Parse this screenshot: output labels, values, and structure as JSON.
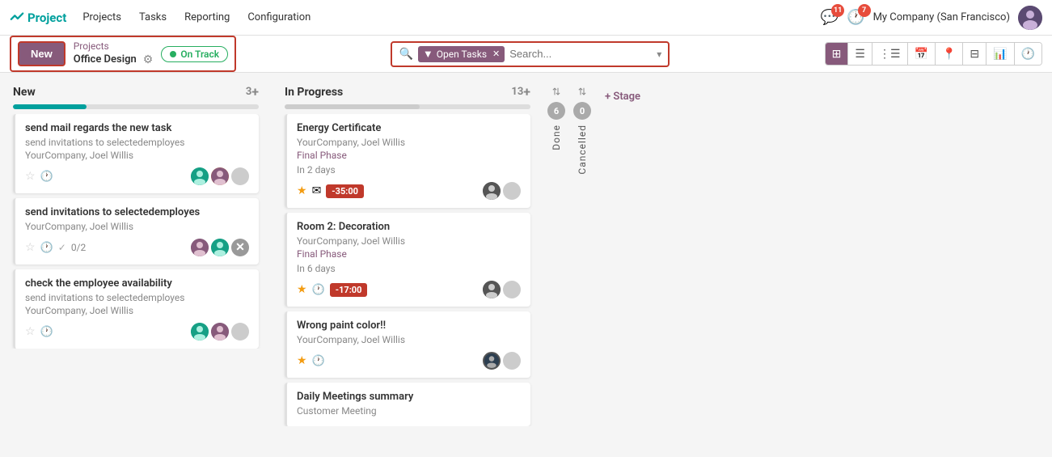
{
  "nav": {
    "logo": "Project",
    "items": [
      "Projects",
      "Tasks",
      "Reporting",
      "Configuration"
    ],
    "messages_count": "11",
    "activities_count": "7",
    "company": "My Company (San Francisco)"
  },
  "breadcrumb": {
    "new_label": "New",
    "project_label": "Projects",
    "current_label": "Office Design",
    "status_label": "On Track"
  },
  "search": {
    "filter_label": "Open Tasks",
    "placeholder": "Search...",
    "dropdown_arrow": "▾"
  },
  "view_buttons": [
    "kanban",
    "list",
    "list2",
    "calendar",
    "pin",
    "grid",
    "chart",
    "clock"
  ],
  "columns": [
    {
      "id": "new",
      "title": "New",
      "count": "3",
      "progress": 30,
      "progress_color": "#00a09d",
      "cards": [
        {
          "id": "c1",
          "title": "send mail regards the new task",
          "subtitle": "send invitations to selectedemployes",
          "company": "YourCompany, Joel Willis",
          "star": false,
          "has_clock": true,
          "subtask_label": null,
          "avatars": [
            "avatar1",
            "avatar2",
            "avatar-grey"
          ]
        },
        {
          "id": "c2",
          "title": "send invitations to selectedemployes",
          "company": "YourCompany, Joel Willis",
          "star": false,
          "has_clock": true,
          "subtask_label": "0/2",
          "avatars": [
            "avatar3",
            "avatar4",
            "avatar-x"
          ]
        },
        {
          "id": "c3",
          "title": "check the employee availability",
          "subtitle": "send invitations to selectedemployes",
          "company": "YourCompany, Joel Willis",
          "star": false,
          "has_clock": true,
          "subtask_label": null,
          "avatars": [
            "avatar1",
            "avatar2",
            "avatar-grey"
          ]
        }
      ]
    },
    {
      "id": "in-progress",
      "title": "In Progress",
      "count": "13",
      "progress": 55,
      "progress_color": "#aaa",
      "cards": [
        {
          "id": "c4",
          "title": "Energy Certificate",
          "subtitle": "YourCompany, Joel Willis",
          "tag": "Final Phase",
          "deadline": "In 2 days",
          "deadline_overdue": false,
          "star": true,
          "has_clock": false,
          "has_mail": true,
          "timer": "-35:00",
          "avatars": [
            "avatar5",
            "avatar-grey2"
          ]
        },
        {
          "id": "c5",
          "title": "Room 2: Decoration",
          "subtitle": "YourCompany, Joel Willis",
          "tag": "Final Phase",
          "deadline": "In 6 days",
          "deadline_overdue": false,
          "star": true,
          "has_clock": true,
          "has_mail": false,
          "timer": "-17:00",
          "avatars": [
            "avatar5",
            "avatar-grey2"
          ]
        },
        {
          "id": "c6",
          "title": "Wrong paint color!!",
          "subtitle": "YourCompany, Joel Willis",
          "tag": null,
          "deadline": null,
          "star": true,
          "has_clock": true,
          "has_mail": false,
          "timer": null,
          "avatars": [
            "avatar-special",
            "avatar-grey2"
          ]
        },
        {
          "id": "c7",
          "title": "Daily Meetings summary",
          "subtitle": "Customer Meeting",
          "tag": null,
          "deadline": null,
          "star": false,
          "has_clock": false,
          "has_mail": false,
          "timer": null,
          "avatars": []
        }
      ]
    }
  ],
  "collapsed_columns": [
    {
      "label": "Done",
      "count": "6"
    },
    {
      "label": "Cancelled",
      "count": "0"
    }
  ],
  "add_stage": "+ Stage"
}
